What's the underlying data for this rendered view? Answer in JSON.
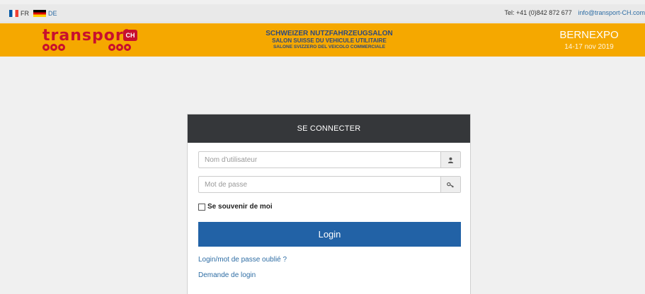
{
  "topbar": {
    "languages": [
      {
        "code": "FR"
      },
      {
        "code": "DE"
      }
    ],
    "phone": "Tel: +41 (0)842 872 677",
    "email": "info@transport-CH.com"
  },
  "header": {
    "logo_text": "transport",
    "logo_badge": "CH",
    "salon_lines": [
      "SCHWEIZER NUTZFAHRZEUGSALON",
      "SALON SUISSE DU VEHICULE UTILITAIRE",
      "SALONE SVIZZERO DEL VEICOLO COMMERCIALE"
    ],
    "venue": "BERNEXPO",
    "dates": "14-17 nov 2019"
  },
  "login": {
    "title": "SE CONNECTER",
    "username_placeholder": "Nom d'utilisateur",
    "password_placeholder": "Mot de passe",
    "remember_label": "Se souvenir de moi",
    "submit_label": "Login",
    "forgot_link": "Login/mot de passe oublié ?",
    "request_link": "Demande de login"
  },
  "colors": {
    "header_orange": "#f5a800",
    "brand_red": "#c8102e",
    "panel_head": "#35373a",
    "button_blue": "#2262a6",
    "link_blue": "#2e6da4"
  },
  "icons": {
    "username_addon": "user-icon",
    "password_addon": "key-icon"
  }
}
